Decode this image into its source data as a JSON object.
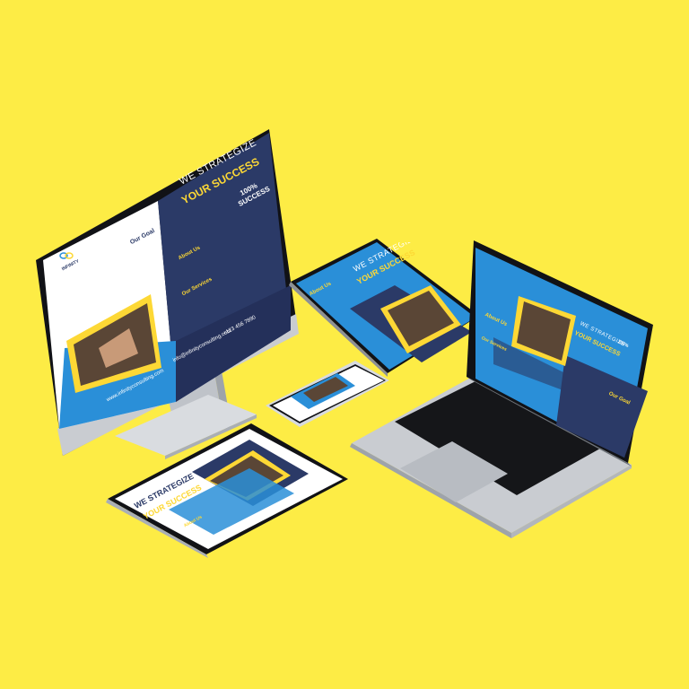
{
  "brand": {
    "logo_text": "INFINITY",
    "logo_sub": "CONSULTING"
  },
  "flyer": {
    "headline_line1": "WE STRATEGIZE",
    "headline_line2": "YOUR SUCCESS",
    "badge_line1": "100%",
    "badge_line2": "SUCCESS",
    "about_title": "About Us",
    "goal_title": "Our Goal",
    "services_title": "Our Services",
    "website": "www.infinityconsulting.com",
    "email": "info@infinityconsulting.com",
    "phone": "+123 456 7890"
  },
  "colors": {
    "background": "#FDEC45",
    "navy": "#2B3A67",
    "blue": "#2A8FD8",
    "accent_yellow": "#FDD835",
    "device_silver": "#C9CCD1",
    "device_black": "#111111"
  },
  "devices": [
    "desktop-monitor",
    "tablet-landscape",
    "smartphone",
    "laptop",
    "tablet-flat"
  ]
}
